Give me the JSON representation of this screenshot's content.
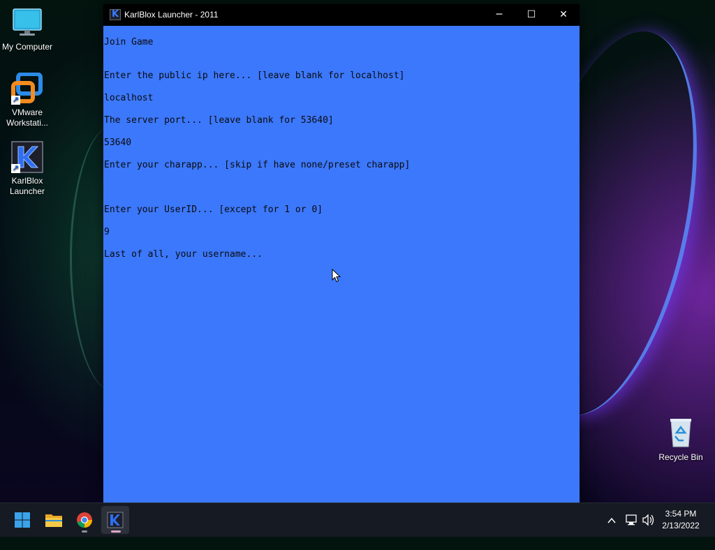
{
  "desktop": {
    "icons": [
      {
        "label": "My Computer"
      },
      {
        "label": "VMware Workstati..."
      },
      {
        "label": "KarlBlox Launcher"
      },
      {
        "label": "Recycle Bin"
      }
    ]
  },
  "window": {
    "title": "KarlBlox Launcher - 2011",
    "logo_letter": "K",
    "controls": {
      "minimize": "─",
      "maximize": "☐",
      "close": "✕"
    },
    "background_color": "#3c78fc",
    "console_lines": [
      "Join Game",
      "Enter the public ip here... [leave blank for localhost]",
      "localhost",
      "The server port... [leave blank for 53640]",
      "53640",
      "Enter your charapp... [skip if have none/preset charapp]",
      "Enter your UserID... [except for 1 or 0]",
      "9",
      "Last of all, your username..."
    ]
  },
  "taskbar": {
    "items": [
      {
        "name": "start-button"
      },
      {
        "name": "file-explorer"
      },
      {
        "name": "chrome"
      },
      {
        "name": "karlblox-launcher",
        "active": true
      }
    ],
    "tray": {
      "chevron": "^",
      "network": "network-icon",
      "volume": "volume-icon"
    },
    "clock": {
      "time": "3:54 PM",
      "date": "2/13/2022"
    }
  }
}
